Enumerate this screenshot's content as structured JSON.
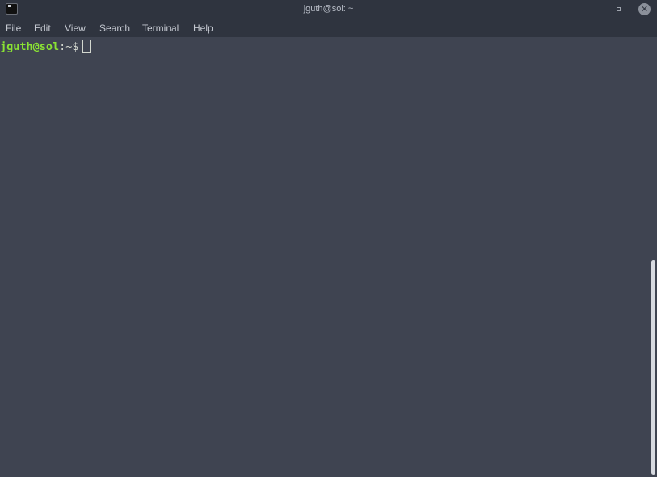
{
  "window": {
    "title": "jguth@sol: ~",
    "icon": "terminal-icon",
    "controls": {
      "minimize_icon": "minimize-icon",
      "maximize_icon": "maximize-icon",
      "close_glyph": "✕"
    }
  },
  "menu": {
    "items": [
      "File",
      "Edit",
      "View",
      "Search",
      "Terminal",
      "Help"
    ]
  },
  "terminal": {
    "prompt_user_host": "jguth@sol",
    "prompt_path": ":~$",
    "colors": {
      "background": "#3f4451",
      "user_host": "#8ae234",
      "text": "#d3d7cf"
    }
  },
  "scrollbar": {
    "thumb_color": "#d7dae0"
  }
}
